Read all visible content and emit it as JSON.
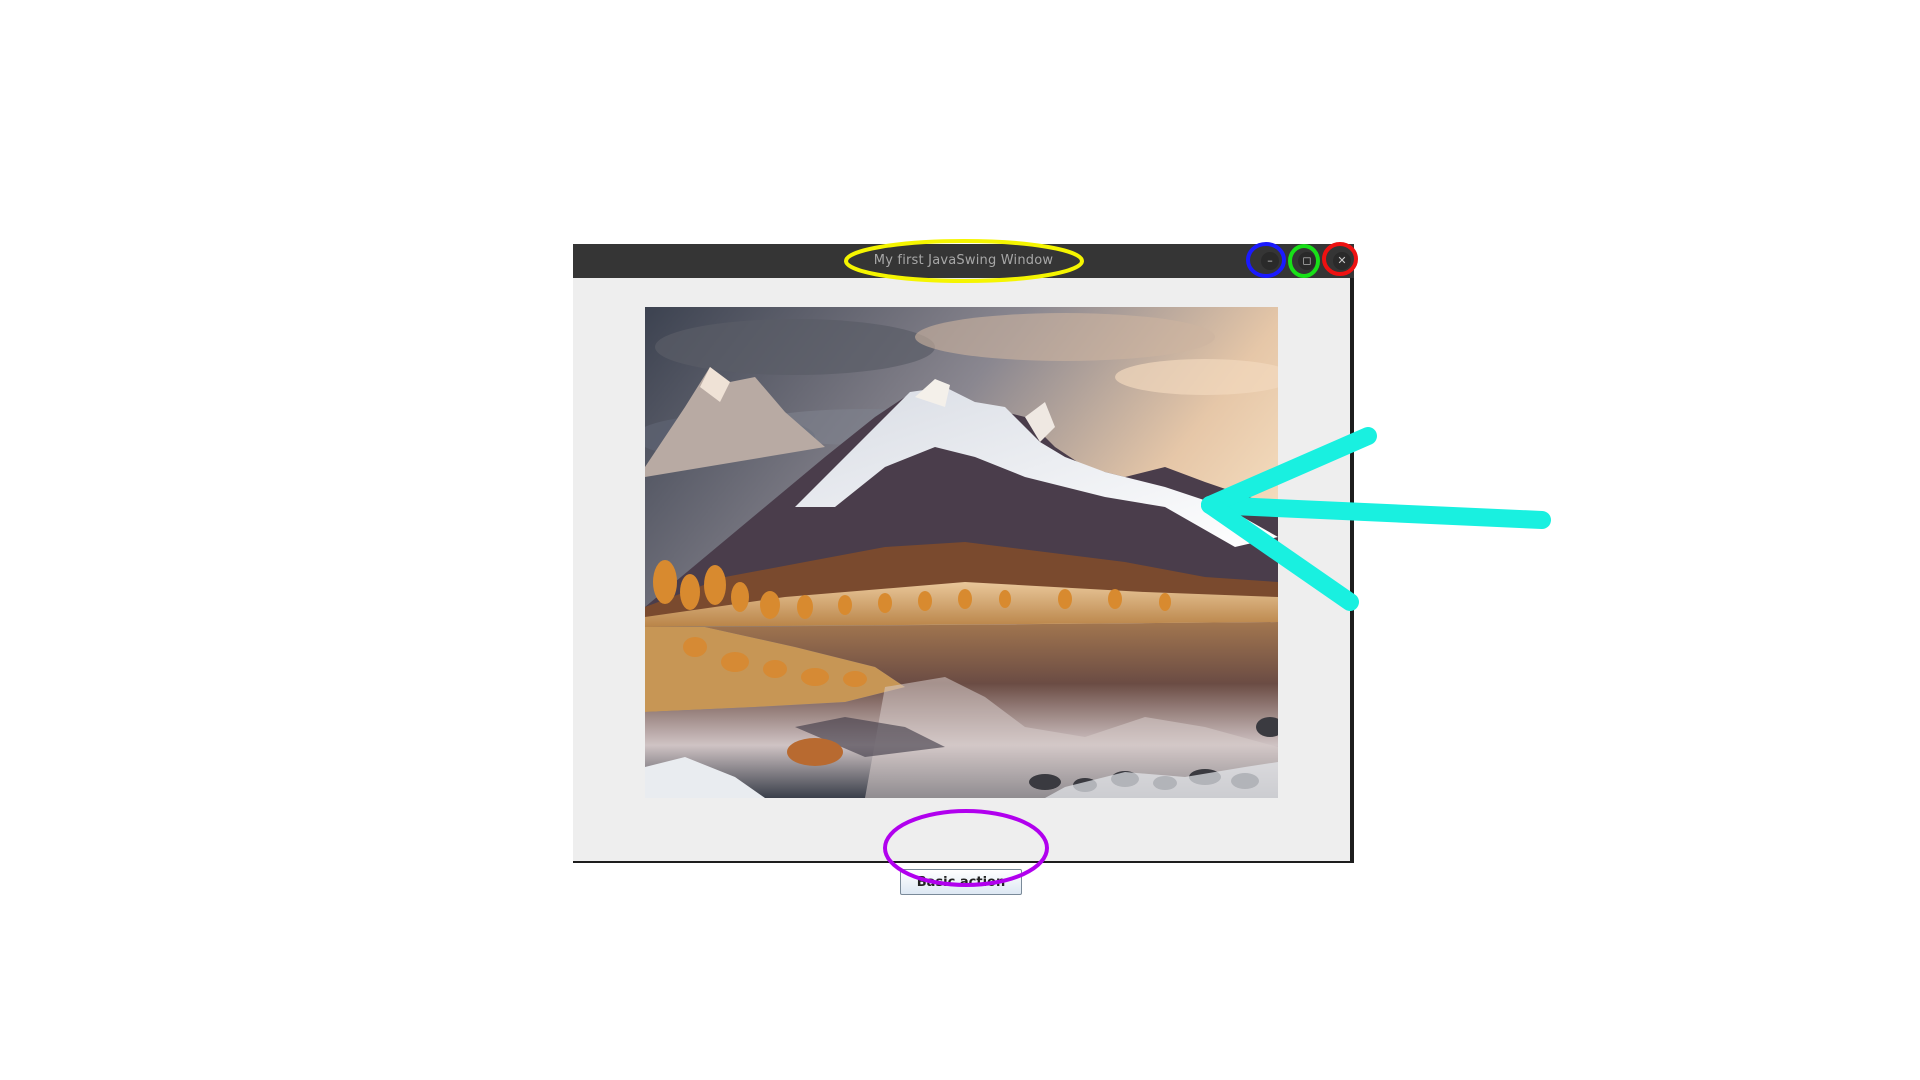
{
  "window": {
    "title": "My first JavaSwing Window",
    "controls": {
      "minimize_glyph": "–",
      "maximize_glyph": "◻",
      "close_glyph": "✕"
    }
  },
  "content": {
    "image_subject": "mountain-lake-landscape",
    "button_label": "Basic action"
  },
  "annotations": {
    "title_highlight_color": "#f5f500",
    "minimize_highlight_color": "#1a1aff",
    "maximize_highlight_color": "#18e018",
    "close_highlight_color": "#ee1111",
    "button_highlight_color": "#b100ee",
    "arrow_color": "#19f0e0"
  }
}
